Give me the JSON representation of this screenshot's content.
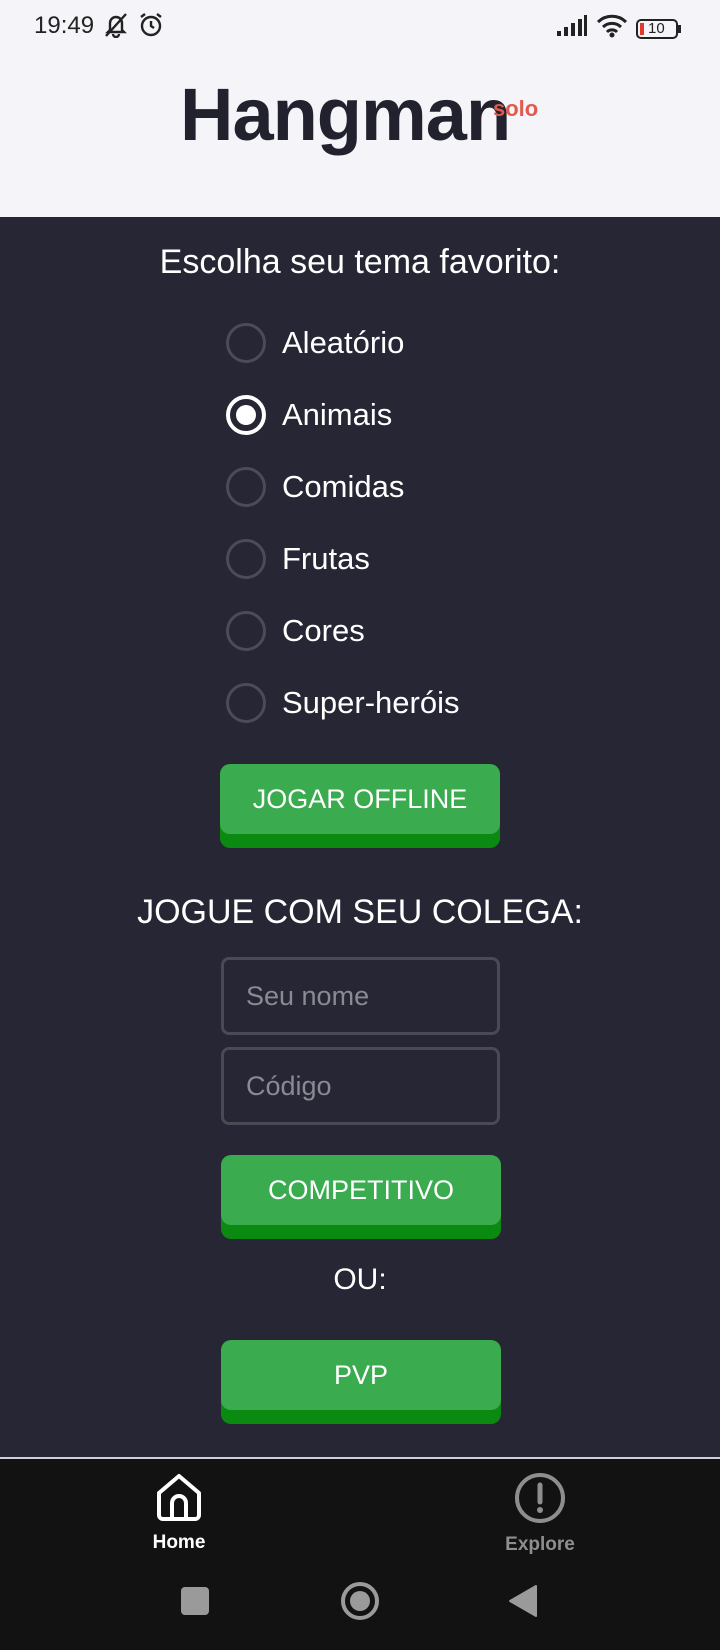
{
  "status_bar": {
    "time": "19:49",
    "battery": "10",
    "icons": [
      "notifications-off-icon",
      "alarm-icon",
      "signal-icon",
      "wifi-icon",
      "battery-icon"
    ]
  },
  "header": {
    "title": "Hangman",
    "badge": "solo"
  },
  "theme_section": {
    "heading": "Escolha seu tema favorito:",
    "options": [
      {
        "label": "Aleatório",
        "selected": false
      },
      {
        "label": "Animais",
        "selected": true
      },
      {
        "label": "Comidas",
        "selected": false
      },
      {
        "label": "Frutas",
        "selected": false
      },
      {
        "label": "Cores",
        "selected": false
      },
      {
        "label": "Super-heróis",
        "selected": false
      }
    ],
    "play_offline_label": "JOGAR OFFLINE"
  },
  "multiplayer": {
    "heading": "JOGUE COM SEU COLEGA:",
    "name_placeholder": "Seu nome",
    "name_value": "",
    "code_placeholder": "Código",
    "code_value": "",
    "competitive_label": "COMPETITIVO",
    "or_label": "OU:",
    "pvp_label": "PVP"
  },
  "bottom_nav": {
    "items": [
      {
        "label": "Home",
        "icon": "home-icon",
        "active": true
      },
      {
        "label": "Explore",
        "icon": "alert-circle-icon",
        "active": false
      }
    ]
  },
  "system_nav": {
    "icons": [
      "recents-square-icon",
      "home-circle-icon",
      "back-triangle-icon"
    ]
  },
  "colors": {
    "background": "#262634",
    "header_bg": "#f5f4f9",
    "button_green": "#3aab4f",
    "button_shadow": "#0a8a10",
    "badge_red": "#e05a4e",
    "nav_bg": "#121212"
  }
}
